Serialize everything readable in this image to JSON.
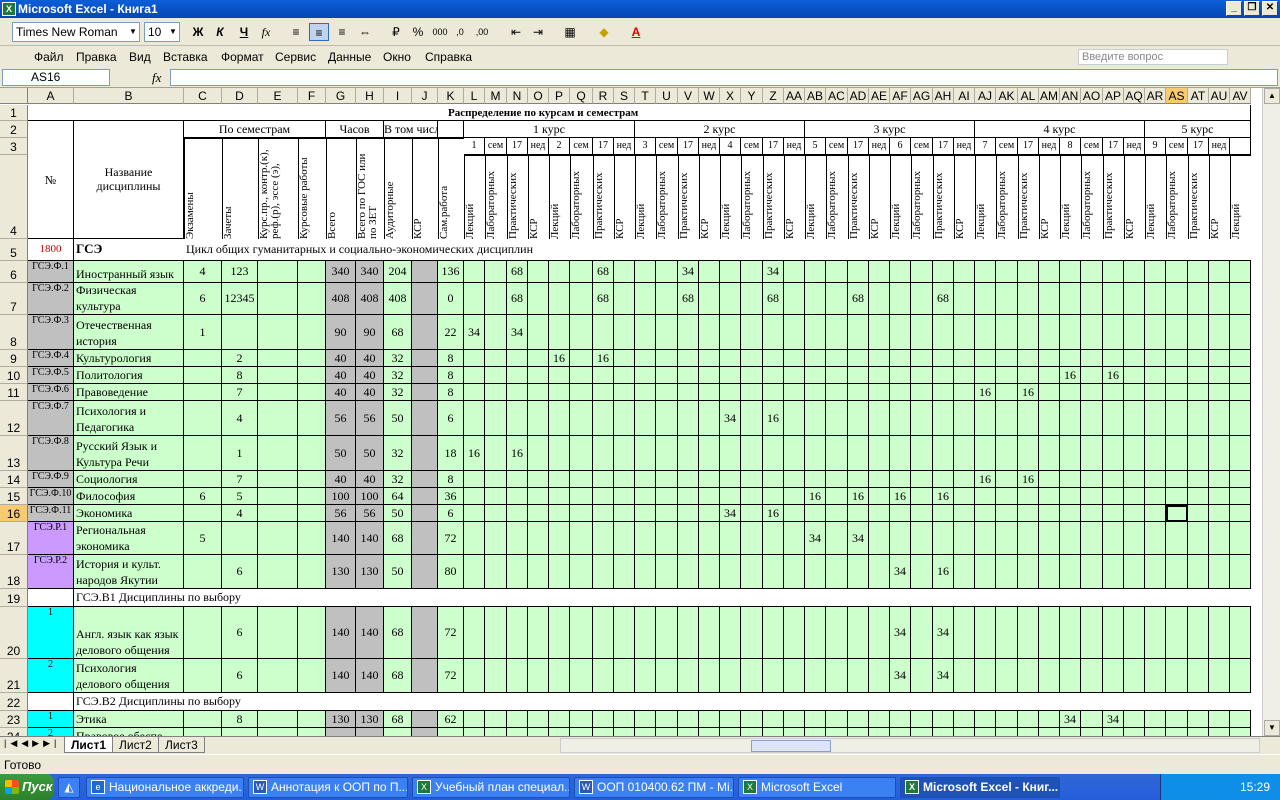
{
  "window": {
    "title": "Microsoft Excel - Книга1"
  },
  "toolbar": {
    "font": "Times New Roman",
    "size": "10",
    "bold": "Ж",
    "italic": "К",
    "underline": "Ч",
    "fx": "fx"
  },
  "menu": [
    "Файл",
    "Правка",
    "Вид",
    "Вставка",
    "Формат",
    "Сервис",
    "Данные",
    "Окно",
    "Справка"
  ],
  "question_placeholder": "Введите вопрос",
  "namebox": "AS16",
  "columns": [
    "A",
    "B",
    "C",
    "D",
    "E",
    "F",
    "G",
    "H",
    "I",
    "J",
    "K",
    "L",
    "M",
    "N",
    "O",
    "P",
    "Q",
    "R",
    "S",
    "T",
    "U",
    "V",
    "W",
    "X",
    "Y",
    "Z",
    "AA",
    "AB",
    "AC",
    "AD",
    "AE",
    "AF",
    "AG",
    "AH",
    "AI",
    "AJ",
    "AK",
    "AL",
    "AM",
    "AN",
    "AO",
    "AP",
    "AQ",
    "AR",
    "AS",
    "AT",
    "AU",
    "AV"
  ],
  "rows": [
    "1",
    "2",
    "3",
    "4",
    "5",
    "6",
    "7",
    "8",
    "9",
    "10",
    "11",
    "12",
    "13",
    "14",
    "15",
    "16",
    "17",
    "18",
    "19",
    "20",
    "21",
    "22",
    "23",
    "24"
  ],
  "header": {
    "dist": "Распределение по курсам и семестрам",
    "no": "№",
    "name": "Название дисциплины",
    "by_sem": "По семестрам",
    "hours": "Часов",
    "incl": "В том числе",
    "course1": "1 курс",
    "course2": "2 курс",
    "course3": "3 курс",
    "course4": "4 курс",
    "course5": "5 курс",
    "exams": "Экзамены",
    "credits": "Зачеты",
    "kurs_pr": "Курс.пр., контр.(к), реф.(р), эссе (э),",
    "kurs_raboty": "Курсовые работы",
    "total": "Всего",
    "gos": "Всего по ГОС или по ЗЕТ",
    "aud": "Аудиторные",
    "ksr": "КСР",
    "sam": "Сам.работа",
    "lek": "Лекций",
    "lab": "Лабораторных",
    "prak": "Практических",
    "ksr2": "КСР",
    "sem_labels": [
      "1",
      "сем",
      "17",
      "нед",
      "2",
      "сем",
      "17",
      "нед",
      "3",
      "сем",
      "17",
      "нед",
      "4",
      "сем",
      "17",
      "нед",
      "5",
      "сем",
      "17",
      "нед",
      "6",
      "сем",
      "17",
      "нед",
      "7",
      "сем",
      "17",
      "нед",
      "8",
      "сем",
      "17",
      "нед",
      "9",
      "сем",
      "17",
      "нед"
    ]
  },
  "row5": {
    "a": "1800",
    "b": "ГСЭ",
    "c": "Цикл общих гуманитарных и социально-экономических дисциплин"
  },
  "row19": "ГСЭ.В1 Дисциплины по выбору",
  "row22": "ГСЭ.В2 Дисциплины по выбору",
  "data_rows": [
    {
      "code": "ГСЭ.Ф.1",
      "name": "Иностранный язык",
      "exam": "4",
      "cred": "123",
      "total": "340",
      "gos": "340",
      "aud": "204",
      "sam": "136",
      "cells": {
        "N": "68",
        "R": "68",
        "V": "34",
        "Z": "34"
      }
    },
    {
      "code": "ГСЭ.Ф.2",
      "name": "Физическая культура",
      "exam": "6",
      "cred": "12345",
      "total": "408",
      "gos": "408",
      "aud": "408",
      "sam": "0",
      "cells": {
        "N": "68",
        "R": "68",
        "V": "68",
        "Z": "68",
        "AD": "68",
        "AH": "68"
      }
    },
    {
      "code": "ГСЭ.Ф.3",
      "name": "Отечественная история",
      "exam": "1",
      "cred": "",
      "total": "90",
      "gos": "90",
      "aud": "68",
      "sam": "22",
      "cells": {
        "L": "34",
        "N": "34"
      }
    },
    {
      "code": "ГСЭ.Ф.4",
      "name": "Культурология",
      "exam": "",
      "cred": "2",
      "total": "40",
      "gos": "40",
      "aud": "32",
      "sam": "8",
      "cells": {
        "P": "16",
        "R": "16"
      }
    },
    {
      "code": "ГСЭ.Ф.5",
      "name": "Политология",
      "exam": "",
      "cred": "8",
      "total": "40",
      "gos": "40",
      "aud": "32",
      "sam": "8",
      "cells": {
        "AN": "16",
        "AP": "16"
      }
    },
    {
      "code": "ГСЭ.Ф.6",
      "name": "Правоведение",
      "exam": "",
      "cred": "7",
      "total": "40",
      "gos": "40",
      "aud": "32",
      "sam": "8",
      "cells": {
        "AJ": "16",
        "AL": "16"
      }
    },
    {
      "code": "ГСЭ.Ф.7",
      "name": "Психология и Педагогика",
      "exam": "",
      "cred": "4",
      "total": "56",
      "gos": "56",
      "aud": "50",
      "sam": "6",
      "cells": {
        "X": "34",
        "Z": "16"
      }
    },
    {
      "code": "ГСЭ.Ф.8",
      "name": "Русский Язык и Культура Речи",
      "exam": "",
      "cred": "1",
      "total": "50",
      "gos": "50",
      "aud": "32",
      "sam": "18",
      "cells": {
        "L": "16",
        "N": "16"
      }
    },
    {
      "code": "ГСЭ.Ф.9",
      "name": "Социология",
      "exam": "",
      "cred": "7",
      "total": "40",
      "gos": "40",
      "aud": "32",
      "sam": "8",
      "cells": {
        "AJ": "16",
        "AL": "16"
      }
    },
    {
      "code": "ГСЭ.Ф.10",
      "name": "Философия",
      "exam": "6",
      "cred": "5",
      "total": "100",
      "gos": "100",
      "aud": "64",
      "sam": "36",
      "cells": {
        "AB": "16",
        "AD": "16",
        "AF": "16",
        "AH": "16"
      }
    },
    {
      "code": "ГСЭ.Ф.11",
      "name": "Экономика",
      "exam": "",
      "cred": "4",
      "total": "56",
      "gos": "56",
      "aud": "50",
      "sam": "6",
      "cells": {
        "X": "34",
        "Z": "16"
      }
    },
    {
      "code": "ГСЭ.Р.1",
      "name": "Региональная экономика",
      "exam": "5",
      "cred": "",
      "total": "140",
      "gos": "140",
      "aud": "68",
      "sam": "72",
      "cells": {
        "AB": "34",
        "AD": "34"
      }
    },
    {
      "code": "ГСЭ.Р.2",
      "name": "История и культ. народов Якутии",
      "exam": "",
      "cred": "6",
      "total": "130",
      "gos": "130",
      "aud": "50",
      "sam": "80",
      "cells": {
        "AF": "34",
        "AH": "16"
      }
    },
    {
      "code": "1",
      "name": "Англ. язык как язык делового общения",
      "exam": "",
      "cred": "6",
      "total": "140",
      "gos": "140",
      "aud": "68",
      "sam": "72",
      "cells": {
        "AF": "34",
        "AH": "34"
      }
    },
    {
      "code": "2",
      "name": "Психология делового общения",
      "exam": "",
      "cred": "6",
      "total": "140",
      "gos": "140",
      "aud": "68",
      "sam": "72",
      "cells": {
        "AF": "34",
        "AH": "34"
      }
    },
    {
      "code": "1",
      "name": "Этика",
      "exam": "",
      "cred": "8",
      "total": "130",
      "gos": "130",
      "aud": "68",
      "sam": "62",
      "cells": {
        "AN": "34",
        "AP": "34"
      }
    },
    {
      "code": "2",
      "name": "Правовое обеспе-",
      "exam": "",
      "cred": "",
      "total": "",
      "gos": "",
      "aud": "",
      "sam": "",
      "cells": {}
    }
  ],
  "sheets": [
    "Лист1",
    "Лист2",
    "Лист3"
  ],
  "status": "Готово",
  "taskbar": {
    "start": "Пуск",
    "items": [
      "Национальное аккреди...",
      "Аннотация к ООП по П...",
      "Учебный план специал...",
      "ООП 010400.62 ПМ - Mi...",
      "Microsoft Excel",
      "Microsoft Excel - Книг..."
    ],
    "clock": "15:29"
  }
}
